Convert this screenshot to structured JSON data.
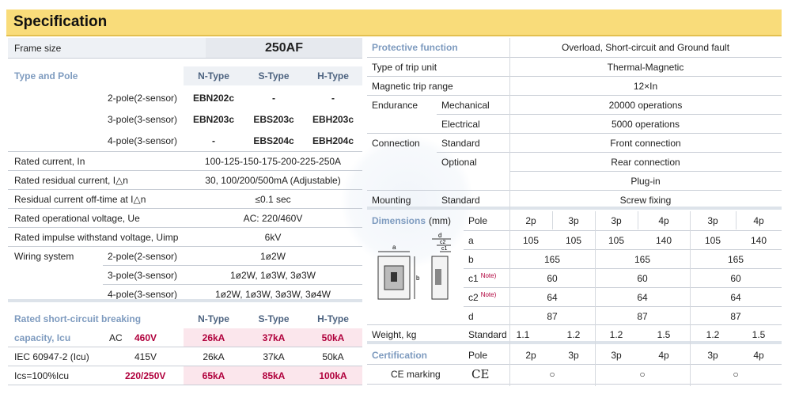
{
  "title": "Specification",
  "left": {
    "frame_size_label": "Frame size",
    "frame_size_value": "250AF",
    "type_pole_label": "Type and Pole",
    "types": [
      "N-Type",
      "S-Type",
      "H-Type"
    ],
    "poles": [
      {
        "label": "2-pole(2-sensor)",
        "n": "EBN202c",
        "s": "-",
        "h": "-"
      },
      {
        "label": "3-pole(3-sensor)",
        "n": "EBN203c",
        "s": "EBS203c",
        "h": "EBH203c"
      },
      {
        "label": "4-pole(3-sensor)",
        "n": "-",
        "s": "EBS204c",
        "h": "EBH204c"
      }
    ],
    "specs": [
      {
        "label": "Rated current, In",
        "value": "100-125-150-175-200-225-250A"
      },
      {
        "label": "Rated residual current, I△n",
        "value": "30, 100/200/500mA (Adjustable)"
      },
      {
        "label": "Residual current off-time at I△n",
        "value": "≤0.1 sec"
      },
      {
        "label": "Rated operational voltage, Ue",
        "value": "AC: 220/460V"
      },
      {
        "label": "Rated impulse withstand voltage, Uimp",
        "value": "6kV"
      }
    ],
    "wiring_label": "Wiring system",
    "wiring": [
      {
        "pole": "2-pole(2-sensor)",
        "value": "1ø2W"
      },
      {
        "pole": "3-pole(3-sensor)",
        "value": "1ø2W, 1ø3W, 3ø3W"
      },
      {
        "pole": "4-pole(3-sensor)",
        "value": "1ø2W, 1ø3W, 3ø3W, 3ø4W"
      }
    ],
    "breaking_label_1": "Rated short-circuit breaking",
    "breaking_label_2": "capacity, Icu",
    "breaking_types": [
      "N-Type",
      "S-Type",
      "H-Type"
    ],
    "breaking_rows": [
      {
        "label": "",
        "ac": "AC",
        "voltage": "460V",
        "n": "26kA",
        "s": "37kA",
        "h": "50kA",
        "red": true
      },
      {
        "label": "IEC 60947-2 (Icu)",
        "ac": "",
        "voltage": "415V",
        "n": "26kA",
        "s": "37kA",
        "h": "50kA",
        "red": false
      },
      {
        "label": "Ics=100%Icu",
        "ac": "",
        "voltage": "220/250V",
        "n": "65kA",
        "s": "85kA",
        "h": "100kA",
        "red": true
      }
    ]
  },
  "right": {
    "protective_label": "Protective function",
    "protective_value": "Overload, Short-circuit and Ground fault",
    "trip_unit_label": "Type of trip unit",
    "trip_unit_value": "Thermal-Magnetic",
    "mag_trip_label": "Magnetic trip range",
    "mag_trip_value": "12×In",
    "endurance_label": "Endurance",
    "mechanical_label": "Mechanical",
    "mechanical_value": "20000 operations",
    "electrical_label": "Electrical",
    "electrical_value": "5000 operations",
    "connection_label": "Connection",
    "standard_label": "Standard",
    "front_value": "Front connection",
    "optional_label": "Optional",
    "rear_value": "Rear connection",
    "plugin_value": "Plug-in",
    "mounting_label": "Mounting",
    "mounting_standard_label": "Standard",
    "screw_value": "Screw fixing",
    "dimensions_label": "Dimensions",
    "dimensions_unit": "(mm)",
    "pole_label": "Pole",
    "poles": [
      "2p",
      "3p",
      "3p",
      "4p",
      "3p",
      "4p"
    ],
    "dim_rows": [
      {
        "label": "a",
        "note": "",
        "values": [
          "105",
          "105",
          "105",
          "140",
          "105",
          "140"
        ]
      },
      {
        "label": "b",
        "note": "",
        "values": [
          "165",
          "165",
          "165"
        ]
      },
      {
        "label": "c1",
        "note": "Note)",
        "values": [
          "60",
          "60",
          "60"
        ]
      },
      {
        "label": "c2",
        "note": "Note)",
        "values": [
          "64",
          "64",
          "64"
        ]
      },
      {
        "label": "d",
        "note": "",
        "values": [
          "87",
          "87",
          "87"
        ]
      }
    ],
    "diagram_labels": [
      "a",
      "b",
      "d",
      "c2",
      "c1"
    ],
    "weight_label": "Weight, kg",
    "weight_sub": "Standard",
    "weights": [
      "1.1",
      "1.2",
      "1.2",
      "1.5",
      "1.2",
      "1.5"
    ],
    "cert_label": "Certification",
    "cert_pole_label": "Pole",
    "cert_poles": [
      "2p",
      "3p",
      "3p",
      "4p",
      "3p",
      "4p"
    ],
    "ce_label": "CE marking",
    "ce_logo": "CE",
    "ce_marks": [
      "○",
      "○",
      "○"
    ]
  }
}
